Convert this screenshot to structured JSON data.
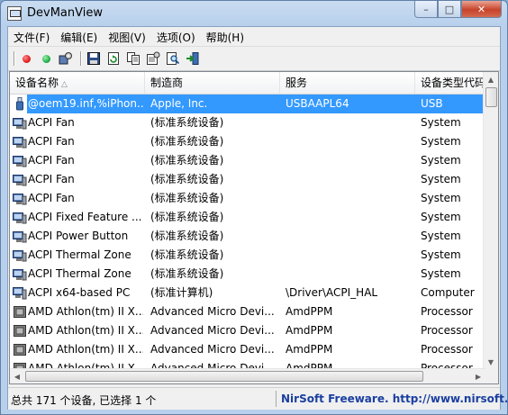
{
  "window": {
    "title": "DevManView",
    "min_label": "–",
    "max_label": "□",
    "close_label": "✕"
  },
  "menu": [
    "文件(F)",
    "编辑(E)",
    "视图(V)",
    "选项(O)",
    "帮助(H)"
  ],
  "toolbar": {
    "colors": {
      "red": "#e32020",
      "green": "#22b14c"
    },
    "icons": [
      "disable-device-icon",
      "enable-device-icon",
      "device-properties-icon",
      "save-icon",
      "refresh-icon",
      "copy-icon",
      "properties-icon",
      "find-icon",
      "exit-icon"
    ]
  },
  "columns": [
    "设备名称",
    "制造商",
    "服务",
    "设备类型代码"
  ],
  "rows": [
    {
      "name": "@oem19.inf,%iPhon...",
      "manufacturer": "Apple, Inc.",
      "service": "USBAAPL64",
      "type": "USB",
      "icon": "usb-device-icon",
      "selected": true
    },
    {
      "name": "ACPI Fan",
      "manufacturer": "(标准系统设备)",
      "service": "",
      "type": "System",
      "icon": "system-device-icon",
      "selected": false
    },
    {
      "name": "ACPI Fan",
      "manufacturer": "(标准系统设备)",
      "service": "",
      "type": "System",
      "icon": "system-device-icon",
      "selected": false
    },
    {
      "name": "ACPI Fan",
      "manufacturer": "(标准系统设备)",
      "service": "",
      "type": "System",
      "icon": "system-device-icon",
      "selected": false
    },
    {
      "name": "ACPI Fan",
      "manufacturer": "(标准系统设备)",
      "service": "",
      "type": "System",
      "icon": "system-device-icon",
      "selected": false
    },
    {
      "name": "ACPI Fan",
      "manufacturer": "(标准系统设备)",
      "service": "",
      "type": "System",
      "icon": "system-device-icon",
      "selected": false
    },
    {
      "name": "ACPI Fixed Feature ...",
      "manufacturer": "(标准系统设备)",
      "service": "",
      "type": "System",
      "icon": "system-device-icon",
      "selected": false
    },
    {
      "name": "ACPI Power Button",
      "manufacturer": "(标准系统设备)",
      "service": "",
      "type": "System",
      "icon": "system-device-icon",
      "selected": false
    },
    {
      "name": "ACPI Thermal Zone",
      "manufacturer": "(标准系统设备)",
      "service": "",
      "type": "System",
      "icon": "system-device-icon",
      "selected": false
    },
    {
      "name": "ACPI Thermal Zone",
      "manufacturer": "(标准系统设备)",
      "service": "",
      "type": "System",
      "icon": "system-device-icon",
      "selected": false
    },
    {
      "name": "ACPI x64-based PC",
      "manufacturer": "(标准计算机)",
      "service": "\\Driver\\ACPI_HAL",
      "type": "Computer",
      "icon": "computer-device-icon",
      "selected": false
    },
    {
      "name": "AMD Athlon(tm) II X...",
      "manufacturer": "Advanced Micro Devi...",
      "service": "AmdPPM",
      "type": "Processor",
      "icon": "processor-device-icon",
      "selected": false
    },
    {
      "name": "AMD Athlon(tm) II X...",
      "manufacturer": "Advanced Micro Devi...",
      "service": "AmdPPM",
      "type": "Processor",
      "icon": "processor-device-icon",
      "selected": false
    },
    {
      "name": "AMD Athlon(tm) II X...",
      "manufacturer": "Advanced Micro Devi...",
      "service": "AmdPPM",
      "type": "Processor",
      "icon": "processor-device-icon",
      "selected": false
    },
    {
      "name": "AMD Athlon(tm) II X...",
      "manufacturer": "Advanced Micro Devi...",
      "service": "AmdPPM",
      "type": "Processor",
      "icon": "processor-device-icon",
      "selected": false
    }
  ],
  "status": {
    "summary": "总共 171 个设备, 已选择 1 个",
    "credit": "NirSoft Freeware.  http://www.nirsoft.net"
  },
  "colors": {
    "selection": "#3399ff",
    "credit": "#1a3fa0"
  }
}
